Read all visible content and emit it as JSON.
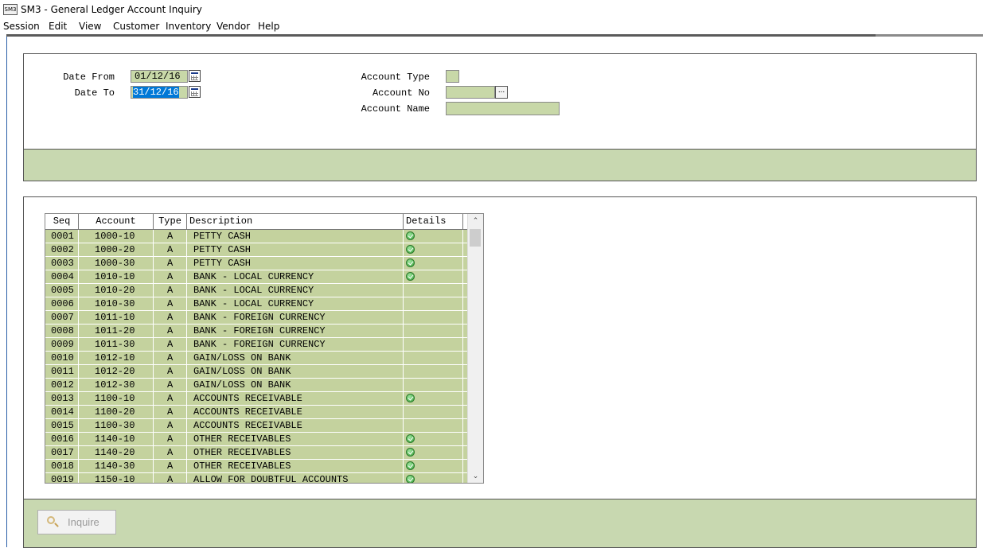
{
  "window": {
    "icon_text": "SM3",
    "title": "SM3 - General Ledger Account Inquiry"
  },
  "menu": [
    "Session",
    "Edit",
    "View",
    "Customer",
    "Inventory",
    "Vendor",
    "Help"
  ],
  "filters": {
    "date_from_label": "Date From",
    "date_from_value": "01/12/16",
    "date_to_label": "Date To",
    "date_to_value": "31/12/16",
    "account_type_label": "Account Type",
    "account_type_value": "",
    "account_no_label": "Account No",
    "account_no_value": "",
    "account_no_lookup": "...",
    "account_name_label": "Account Name",
    "account_name_value": ""
  },
  "table": {
    "columns": [
      "Seq",
      "Account",
      "Type",
      "Description",
      "Details"
    ],
    "rows": [
      {
        "seq": "0001",
        "account": "1000-10",
        "type": "A",
        "description": "PETTY CASH",
        "details": true
      },
      {
        "seq": "0002",
        "account": "1000-20",
        "type": "A",
        "description": "PETTY CASH",
        "details": true
      },
      {
        "seq": "0003",
        "account": "1000-30",
        "type": "A",
        "description": "PETTY CASH",
        "details": true
      },
      {
        "seq": "0004",
        "account": "1010-10",
        "type": "A",
        "description": "BANK - LOCAL CURRENCY",
        "details": true
      },
      {
        "seq": "0005",
        "account": "1010-20",
        "type": "A",
        "description": "BANK - LOCAL CURRENCY",
        "details": false
      },
      {
        "seq": "0006",
        "account": "1010-30",
        "type": "A",
        "description": "BANK - LOCAL CURRENCY",
        "details": false
      },
      {
        "seq": "0007",
        "account": "1011-10",
        "type": "A",
        "description": "BANK - FOREIGN CURRENCY",
        "details": false
      },
      {
        "seq": "0008",
        "account": "1011-20",
        "type": "A",
        "description": "BANK - FOREIGN CURRENCY",
        "details": false
      },
      {
        "seq": "0009",
        "account": "1011-30",
        "type": "A",
        "description": "BANK - FOREIGN CURRENCY",
        "details": false
      },
      {
        "seq": "0010",
        "account": "1012-10",
        "type": "A",
        "description": "GAIN/LOSS ON BANK",
        "details": false
      },
      {
        "seq": "0011",
        "account": "1012-20",
        "type": "A",
        "description": "GAIN/LOSS ON BANK",
        "details": false
      },
      {
        "seq": "0012",
        "account": "1012-30",
        "type": "A",
        "description": "GAIN/LOSS ON BANK",
        "details": false
      },
      {
        "seq": "0013",
        "account": "1100-10",
        "type": "A",
        "description": "ACCOUNTS RECEIVABLE",
        "details": true
      },
      {
        "seq": "0014",
        "account": "1100-20",
        "type": "A",
        "description": "ACCOUNTS RECEIVABLE",
        "details": false
      },
      {
        "seq": "0015",
        "account": "1100-30",
        "type": "A",
        "description": "ACCOUNTS RECEIVABLE",
        "details": false
      },
      {
        "seq": "0016",
        "account": "1140-10",
        "type": "A",
        "description": "OTHER RECEIVABLES",
        "details": true
      },
      {
        "seq": "0017",
        "account": "1140-20",
        "type": "A",
        "description": "OTHER RECEIVABLES",
        "details": true
      },
      {
        "seq": "0018",
        "account": "1140-30",
        "type": "A",
        "description": "OTHER RECEIVABLES",
        "details": true
      },
      {
        "seq": "0019",
        "account": "1150-10",
        "type": "A",
        "description": "ALLOW FOR DOUBTFUL ACCOUNTS",
        "details": true
      }
    ]
  },
  "actions": {
    "inquire_label": "Inquire"
  },
  "colors": {
    "field_green": "#c8d8a8",
    "row_green": "#c4d29e",
    "bar_green": "#c8d8b0",
    "selection": "#0078d7"
  }
}
